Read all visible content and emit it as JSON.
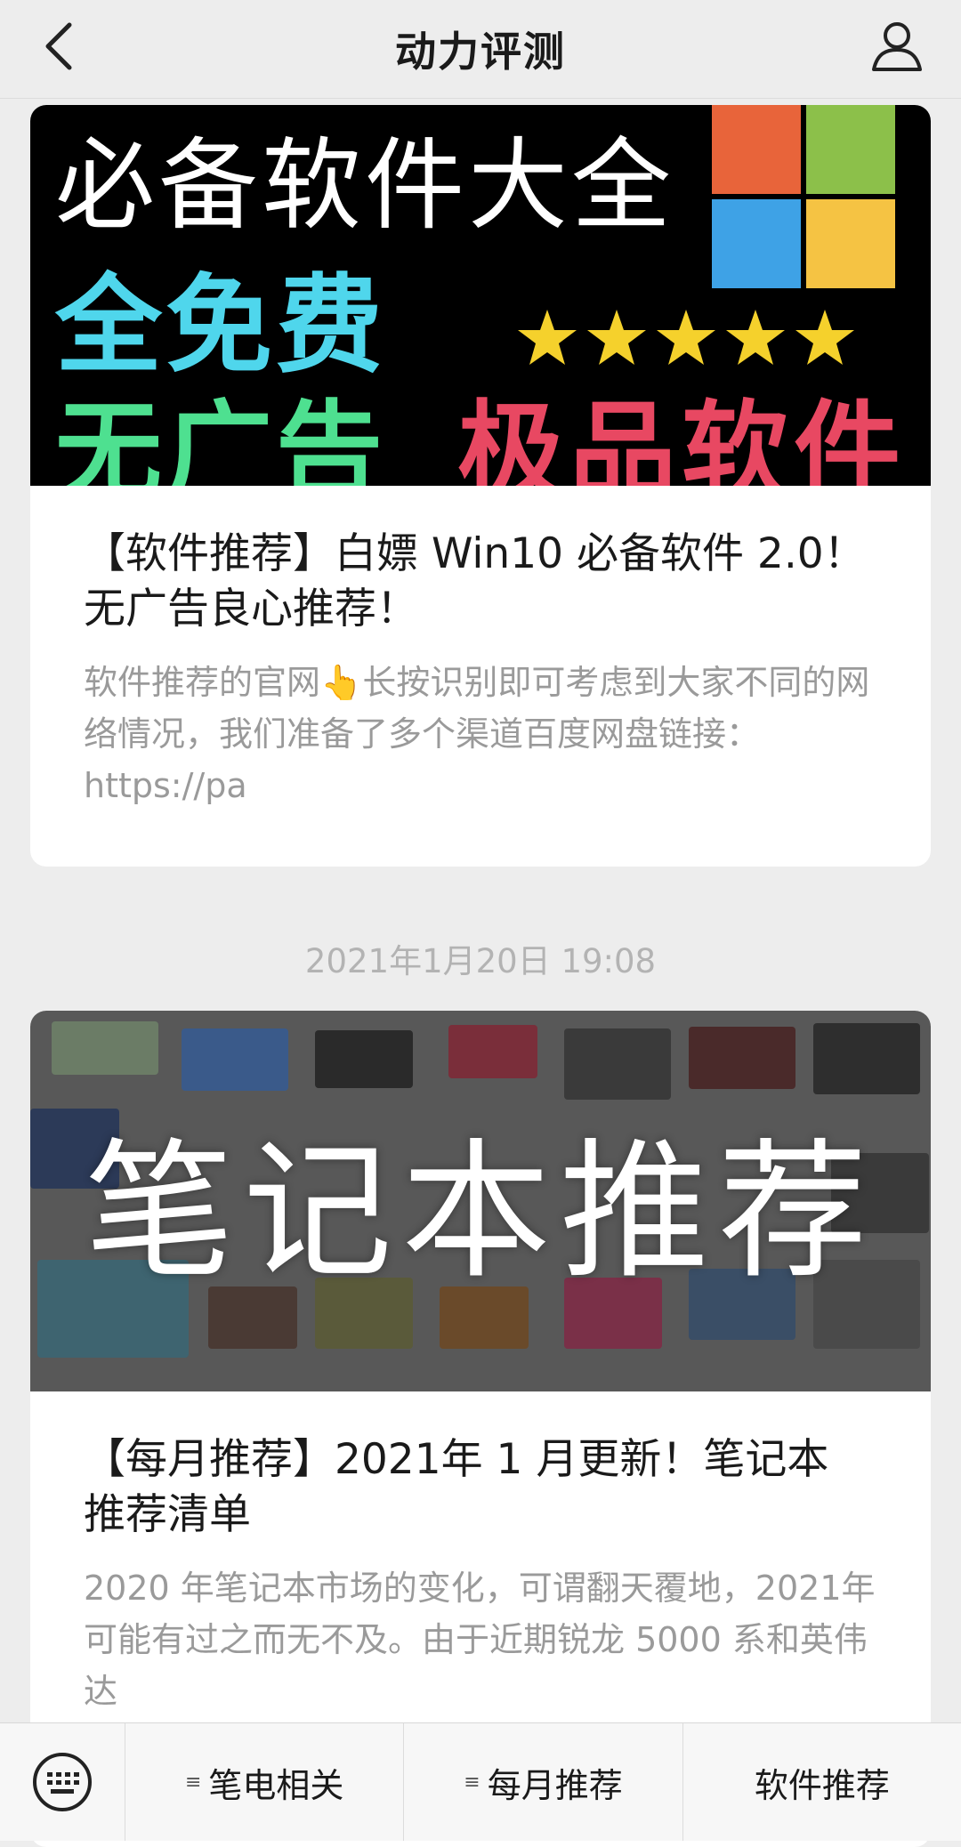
{
  "header": {
    "title": "动力评测"
  },
  "posts": [
    {
      "banner": {
        "line1": "必备软件大全",
        "line2": "全免费",
        "line3": "无广告",
        "line4": "极品软件"
      },
      "title": "【软件推荐】白嫖 Win10 必备软件 2.0！无广告良心推荐！",
      "desc": "软件推荐的官网👆长按识别即可考虑到大家不同的网络情况，我们准备了多个渠道百度网盘链接：https://pa"
    },
    {
      "date": "2021年1月20日 19:08",
      "banner": {
        "text": "笔记本推荐"
      },
      "title": "【每月推荐】2021年 1 月更新！笔记本 推荐清单",
      "desc": "2020 年笔记本市场的变化，可谓翻天覆地，2021年可能有过之而无不及。由于近期锐龙 5000 系和英伟达"
    }
  ],
  "bottom_menu": {
    "keyboard_icon": "keyboard-icon",
    "items": [
      "笔电相关",
      "每月推荐",
      "软件推荐"
    ]
  },
  "colors": {
    "win_red": "#e8643a",
    "win_green": "#8cc04a",
    "win_blue": "#3ea2e6",
    "win_yellow": "#f5c343"
  }
}
